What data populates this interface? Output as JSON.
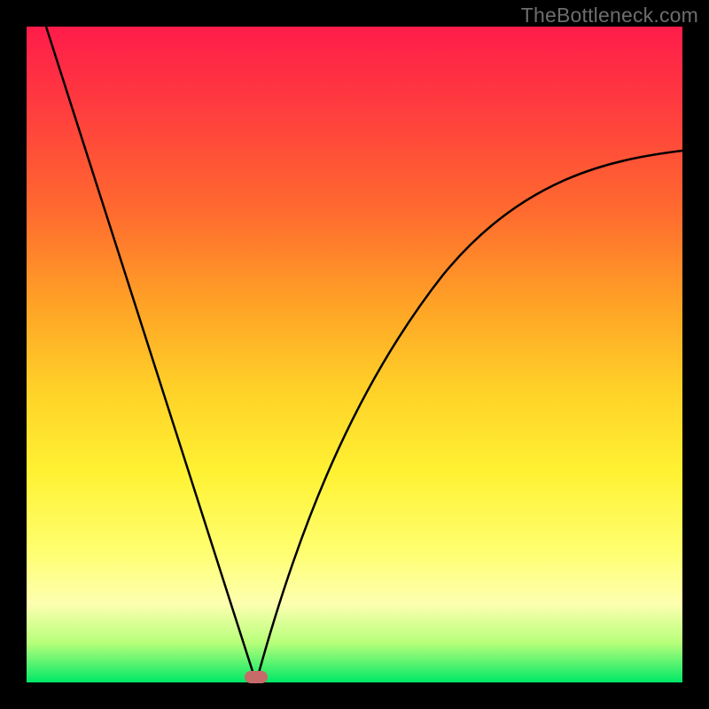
{
  "watermark": "TheBottleneck.com",
  "colors": {
    "black_frame": "#000000",
    "gradient_top": "#ff1c4a",
    "gradient_bottom": "#00e867",
    "curve": "#000000",
    "marker": "#c66a6a"
  },
  "chart_data": {
    "type": "line",
    "title": "",
    "xlabel": "",
    "ylabel": "",
    "xlim": [
      0,
      100
    ],
    "ylim": [
      0,
      100
    ],
    "description": "Bottleneck curve: steep left branch falling from top-left to a minimum at x≈35, then a concave right branch rising toward the upper right. Background is a red-to-green vertical gradient (high values = red = bad, low values near bottom = green = good).",
    "series": [
      {
        "name": "left-branch",
        "x": [
          3,
          6,
          10,
          14,
          18,
          22,
          26,
          30,
          33,
          35
        ],
        "values": [
          100,
          87,
          73,
          60,
          47,
          34,
          22,
          11,
          3,
          0
        ]
      },
      {
        "name": "right-branch",
        "x": [
          35,
          38,
          42,
          48,
          55,
          63,
          72,
          82,
          92,
          100
        ],
        "values": [
          0,
          10,
          22,
          36,
          48,
          58,
          66,
          73,
          78,
          81
        ]
      }
    ],
    "marker": {
      "x": 35,
      "y": 0,
      "shape": "rounded-rect"
    }
  }
}
